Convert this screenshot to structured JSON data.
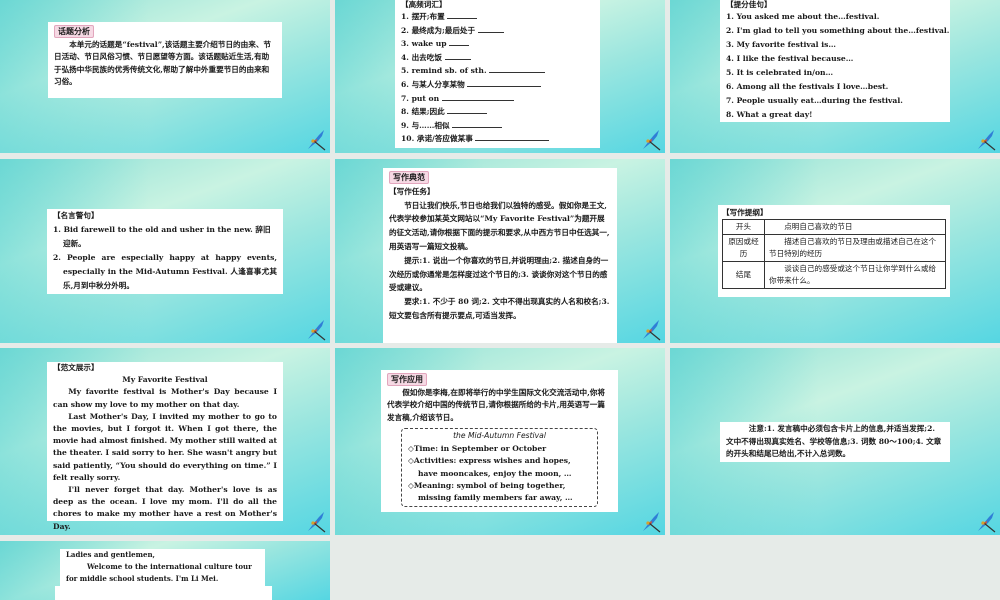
{
  "slides": [
    {
      "tag": "话题分析",
      "body": "本单元的话题是“festival”,该话题主要介绍节日的由来、节日活动、节日风俗习惯、节日愿望等方面。该话题贴近生活,有助于弘扬中华民族的优秀传统文化,帮助了解中外重要节日的由来和习俗。"
    },
    {
      "heading": "【高频词汇】",
      "items": [
        "1. 摆开;布置",
        "2. 最终成为;最后处于",
        "3. wake up",
        "4. 出去吃饭",
        "5. remind sb. of sth.",
        "6. 与某人分享某物",
        "7. put on",
        "8. 结果;因此",
        "9. 与……相似",
        "10. 承诺/答应做某事"
      ]
    },
    {
      "heading": "【提分佳句】",
      "items": [
        "1. You asked me about the…festival.",
        "2. I'm glad to tell you something about the…festival.",
        "3. My favorite festival is…",
        "4. I like the festival because…",
        "5. It is celebrated in/on…",
        "6. Among all the festivals I love…best.",
        "7. People usually eat…during the festival.",
        "8. What a great day!"
      ]
    },
    {
      "heading": "【名言警句】",
      "items": [
        "1. Bid farewell to the old and usher in the new. 辞旧迎新。",
        "2. People are especially happy at happy events, especially in the Mid-Autumn Festival. 人逢喜事尤其乐,月到中秋分外明。"
      ]
    },
    {
      "tag": "写作典范",
      "heading": "【写作任务】",
      "paras": [
        "节日让我们快乐,节日也给我们以独特的感受。假如你是王文,代表学校参加某英文网站以“My Favorite Festival”为题开展的征文活动,请你根据下面的提示和要求,从中西方节日中任选其一,用英语写一篇短文投稿。",
        "提示:1. 说出一个你喜欢的节日,并说明理由;2. 描述自身的一次经历或你通常是怎样度过这个节日的;3. 谈谈你对这个节日的感受或建议。",
        "要求:1. 不少于 80 词;2. 文中不得出现真实的人名和校名;3. 短文要包含所有提示要点,可适当发挥。"
      ]
    },
    {
      "heading": "【写作提纲】",
      "rows": [
        {
          "h": "开头",
          "c": "点明自己喜欢的节日"
        },
        {
          "h": "原因或经历",
          "c": "描述自己喜欢的节日及理由或描述自己在这个节日特别的经历"
        },
        {
          "h": "结尾",
          "c": "谈谈自己的感受或这个节日让你学到什么或给你带来什么。"
        }
      ]
    },
    {
      "heading": "【范文展示】",
      "title": "My Favorite Festival",
      "paras": [
        "My favorite festival is Mother's Day because I can show my love to my mother on that day.",
        "Last Mother's Day, I invited my mother to go to the movies, but I forgot it. When I got there, the movie had almost finished. My mother still waited at the theater. I said sorry to her. She wasn't angry but said patiently, “You should do everything on time.” I felt really sorry.",
        "I'll never forget that day. Mother's love is as deep as the ocean. I love my mom. I'll do all the chores to make my mother have a rest on Mother's Day."
      ]
    },
    {
      "tag": "写作应用",
      "body": "假如你是李梅,在即将举行的中学生国际文化交流活动中,你将代表学校介绍中国的传统节日,请你根据所给的卡片,用英语写一篇发言稿,介绍该节日。",
      "card": {
        "title": "the Mid-Autumn Festival",
        "items": [
          "◇Time: in September or October",
          "◇Activities: express wishes and hopes, have mooncakes, enjoy the moon, …",
          "◇Meaning: symbol of being together, missing family members far away, …"
        ]
      }
    },
    {
      "body": "注意:1. 发言稿中必须包含卡片上的信息,并适当发挥;2. 文中不得出现真实姓名、学校等信息;3. 词数 80～100;4. 文章的开头和结尾已给出,不计入总词数。"
    },
    {
      "line1": "Ladies and gentlemen,",
      "line2": "Welcome to the international culture tour for middle school students. I'm Li Mei."
    }
  ]
}
